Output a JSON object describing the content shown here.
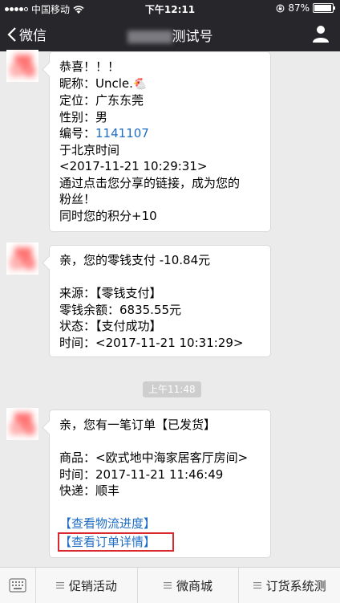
{
  "status_bar": {
    "carrier": "中国移动",
    "time": "下午12:11",
    "battery": "87%",
    "battery_level": 0.87
  },
  "nav": {
    "back_label": "微信",
    "title_visible": "测试号"
  },
  "messages": [
    {
      "lines": [
        "恭喜！！！",
        "昵称：Uncle.",
        "定位：广东东莞",
        "性别：男",
        "编号：",
        "于北京时间",
        "<2017-11-21 10:29:31>",
        "通过点击您分享的链接，成为您的",
        "粉丝！",
        "同时您的积分+10"
      ],
      "id_number": "1141107"
    },
    {
      "lines": [
        "亲，您的零钱支付 -10.84元",
        "来源：【零钱支付】",
        "零钱余额：6835.55元",
        "状态：【支付成功】",
        "时间：<2017-11-21 10:31:29>"
      ]
    },
    {
      "lines": [
        "亲，您有一笔订单【已发货】",
        "商品：<欧式地中海家居客厅房间>",
        "时间：2017-11-21 11:46:49",
        "快递：顺丰"
      ],
      "links": [
        "【查看物流进度】",
        "【查看订单详情】"
      ]
    }
  ],
  "time_chip": "上午11:48",
  "bottom_menu": {
    "items": [
      "促销活动",
      "微商城",
      "订货系统测"
    ]
  }
}
